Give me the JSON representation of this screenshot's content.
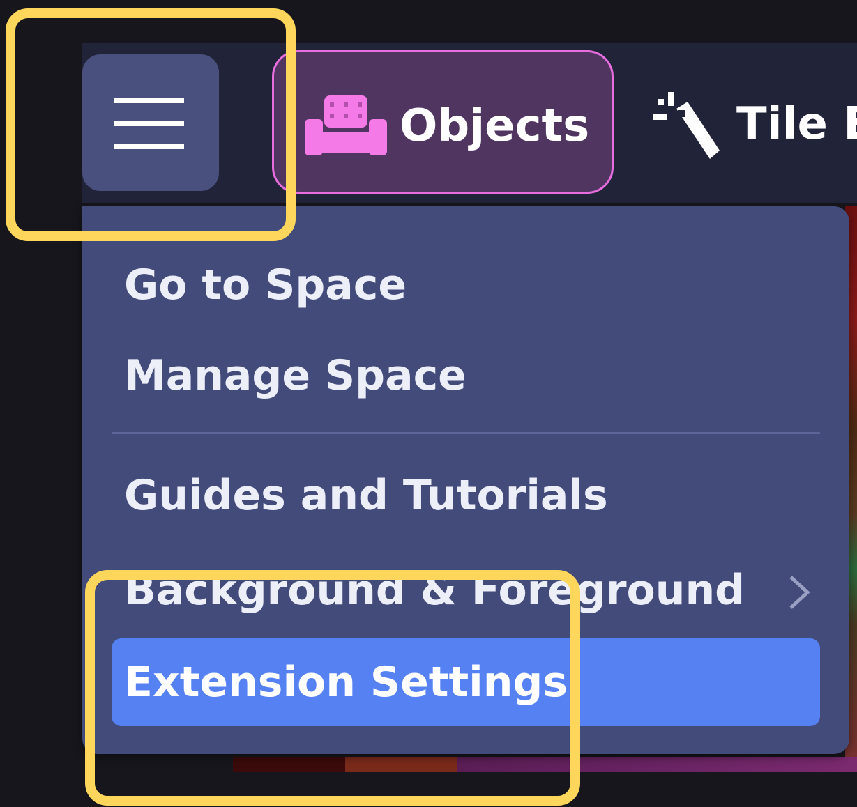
{
  "toolbar": {
    "menu_icon": "hamburger-menu-icon",
    "tabs": [
      {
        "label": "Objects",
        "icon": "sofa-icon",
        "color": "#e86ee0"
      },
      {
        "label": "Tile E",
        "icon": "magic-wand-icon"
      }
    ]
  },
  "menu": {
    "items": [
      {
        "label": "Go to Space"
      },
      {
        "label": "Manage Space"
      },
      {
        "label": "Guides and Tutorials"
      },
      {
        "label": "Background & Foreground",
        "icon": "chevron-right-icon"
      },
      {
        "label": "Extension Settings",
        "active": true
      }
    ]
  },
  "colors": {
    "highlight": "#fdd65b",
    "active_item": "#5581f3",
    "menu_background": "#434b7b"
  }
}
